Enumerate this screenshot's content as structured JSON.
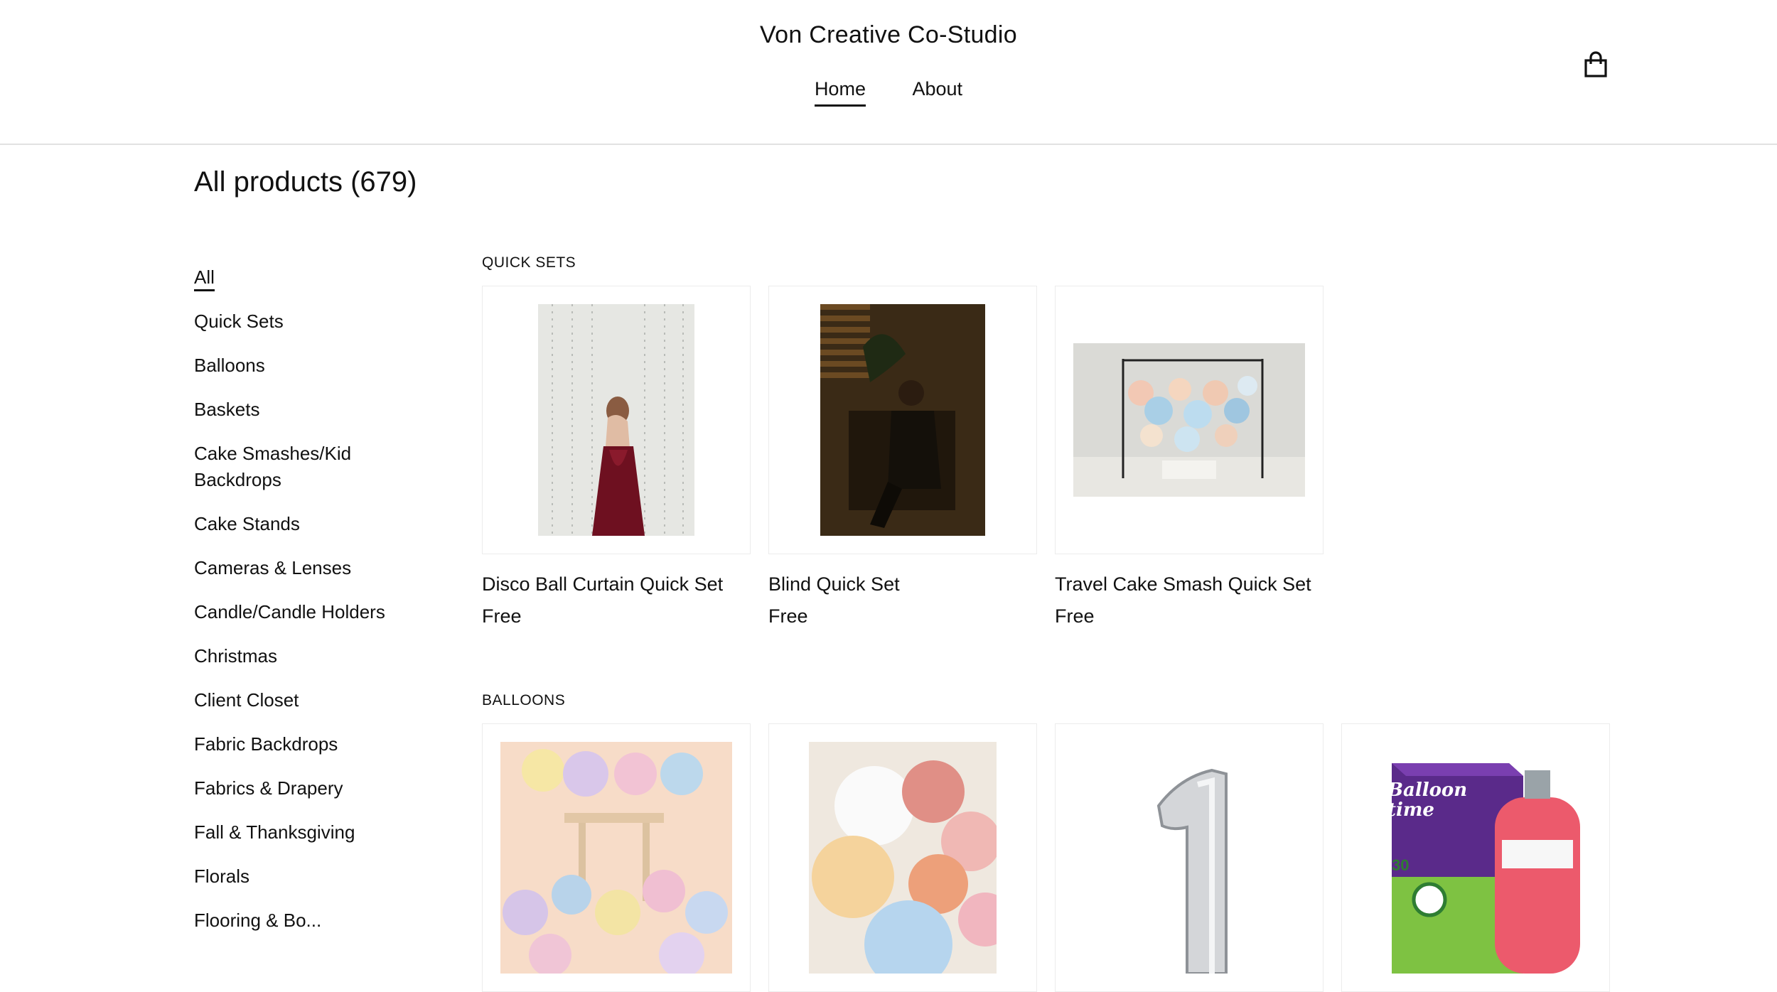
{
  "header": {
    "site_title": "Von Creative Co-Studio",
    "nav": [
      {
        "label": "Home",
        "active": true
      },
      {
        "label": "About",
        "active": false
      }
    ],
    "cart_icon": "shopping-bag-icon"
  },
  "page": {
    "title": "All products (679)"
  },
  "sidebar": {
    "categories": [
      {
        "label": "All",
        "active": true
      },
      {
        "label": "Quick Sets"
      },
      {
        "label": "Balloons"
      },
      {
        "label": "Baskets"
      },
      {
        "label": "Cake Smashes/Kid Backdrops"
      },
      {
        "label": "Cake Stands"
      },
      {
        "label": "Cameras & Lenses"
      },
      {
        "label": "Candle/Candle Holders"
      },
      {
        "label": "Christmas"
      },
      {
        "label": "Client Closet"
      },
      {
        "label": "Fabric Backdrops"
      },
      {
        "label": "Fabrics & Drapery"
      },
      {
        "label": "Fall & Thanksgiving"
      },
      {
        "label": "Florals"
      },
      {
        "label": "Flooring & Bo..."
      }
    ]
  },
  "sections": [
    {
      "title": "QUICK SETS",
      "products": [
        {
          "name": "Disco Ball Curtain Quick Set",
          "price": "Free"
        },
        {
          "name": "Blind Quick Set",
          "price": "Free"
        },
        {
          "name": "Travel Cake Smash Quick Set",
          "price": "Free"
        }
      ]
    },
    {
      "title": "BALLOONS",
      "products": [
        {
          "name": "",
          "price": ""
        },
        {
          "name": "",
          "price": ""
        },
        {
          "name": "",
          "price": ""
        },
        {
          "name": "",
          "price": ""
        }
      ],
      "image_text": {
        "balloon_time": "Balloon time",
        "tank_number": "30"
      }
    }
  ],
  "colors": {
    "text": "#111111",
    "divider": "#e2e2e2",
    "card_border": "#ececec"
  }
}
